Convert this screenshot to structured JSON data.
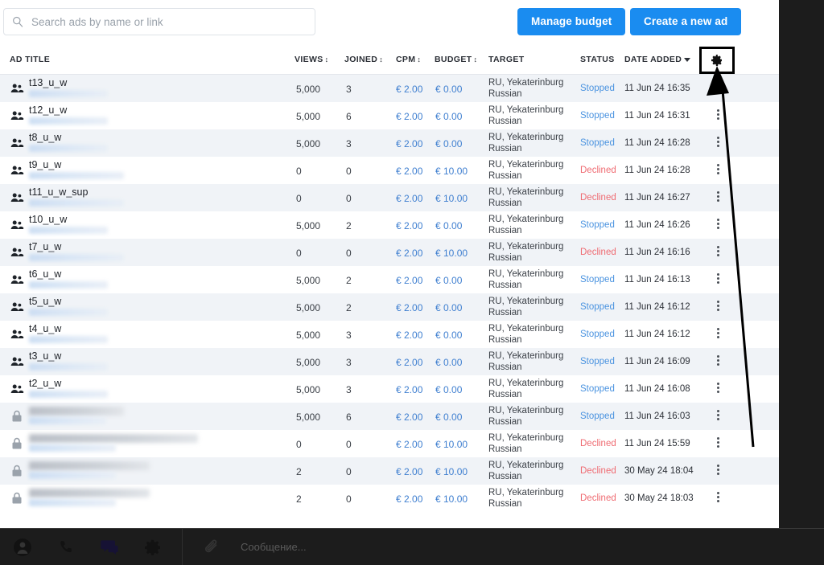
{
  "search": {
    "placeholder": "Search ads by name or link",
    "value": "",
    "icon": "search-icon"
  },
  "toolbar": {
    "manage_budget_label": "Manage budget",
    "create_ad_label": "Create a new ad",
    "accent_color": "#1a8cf0"
  },
  "table": {
    "columns": {
      "ad_title": "AD TITLE",
      "views": "VIEWS",
      "joined": "JOINED",
      "cpm": "CPM",
      "budget": "BUDGET",
      "target": "TARGET",
      "status": "STATUS",
      "date_added": "DATE ADDED"
    },
    "settings_icon": "gear-icon",
    "sort_glyph": "↕",
    "rows": [
      {
        "icon": "group-icon",
        "title": "t13_u_w",
        "redacted": false,
        "views": "5,000",
        "joined": "3",
        "cpm": "€ 2.00",
        "budget": "€ 0.00",
        "target_line1": "RU, Yekaterinburg",
        "target_line2": "Russian",
        "status": "Stopped",
        "status_type": "stopped",
        "date": "11 Jun 24 16:35"
      },
      {
        "icon": "group-icon",
        "title": "t12_u_w",
        "redacted": false,
        "views": "5,000",
        "joined": "6",
        "cpm": "€ 2.00",
        "budget": "€ 0.00",
        "target_line1": "RU, Yekaterinburg",
        "target_line2": "Russian",
        "status": "Stopped",
        "status_type": "stopped",
        "date": "11 Jun 24 16:31"
      },
      {
        "icon": "group-icon",
        "title": "t8_u_w",
        "redacted": false,
        "views": "5,000",
        "joined": "3",
        "cpm": "€ 2.00",
        "budget": "€ 0.00",
        "target_line1": "RU, Yekaterinburg",
        "target_line2": "Russian",
        "status": "Stopped",
        "status_type": "stopped",
        "date": "11 Jun 24 16:28"
      },
      {
        "icon": "group-icon",
        "title": "t9_u_w",
        "redacted": false,
        "views": "0",
        "joined": "0",
        "cpm": "€ 2.00",
        "budget": "€ 10.00",
        "target_line1": "RU, Yekaterinburg",
        "target_line2": "Russian",
        "status": "Declined",
        "status_type": "declined",
        "date": "11 Jun 24 16:28"
      },
      {
        "icon": "group-icon",
        "title": "t11_u_w_sup",
        "redacted": false,
        "views": "0",
        "joined": "0",
        "cpm": "€ 2.00",
        "budget": "€ 10.00",
        "target_line1": "RU, Yekaterinburg",
        "target_line2": "Russian",
        "status": "Declined",
        "status_type": "declined",
        "date": "11 Jun 24 16:27"
      },
      {
        "icon": "group-icon",
        "title": "t10_u_w",
        "redacted": false,
        "views": "5,000",
        "joined": "2",
        "cpm": "€ 2.00",
        "budget": "€ 0.00",
        "target_line1": "RU, Yekaterinburg",
        "target_line2": "Russian",
        "status": "Stopped",
        "status_type": "stopped",
        "date": "11 Jun 24 16:26"
      },
      {
        "icon": "group-icon",
        "title": "t7_u_w",
        "redacted": false,
        "views": "0",
        "joined": "0",
        "cpm": "€ 2.00",
        "budget": "€ 10.00",
        "target_line1": "RU, Yekaterinburg",
        "target_line2": "Russian",
        "status": "Declined",
        "status_type": "declined",
        "date": "11 Jun 24 16:16"
      },
      {
        "icon": "group-icon",
        "title": "t6_u_w",
        "redacted": false,
        "views": "5,000",
        "joined": "2",
        "cpm": "€ 2.00",
        "budget": "€ 0.00",
        "target_line1": "RU, Yekaterinburg",
        "target_line2": "Russian",
        "status": "Stopped",
        "status_type": "stopped",
        "date": "11 Jun 24 16:13"
      },
      {
        "icon": "group-icon",
        "title": "t5_u_w",
        "redacted": false,
        "views": "5,000",
        "joined": "2",
        "cpm": "€ 2.00",
        "budget": "€ 0.00",
        "target_line1": "RU, Yekaterinburg",
        "target_line2": "Russian",
        "status": "Stopped",
        "status_type": "stopped",
        "date": "11 Jun 24 16:12"
      },
      {
        "icon": "group-icon",
        "title": "t4_u_w",
        "redacted": false,
        "views": "5,000",
        "joined": "3",
        "cpm": "€ 2.00",
        "budget": "€ 0.00",
        "target_line1": "RU, Yekaterinburg",
        "target_line2": "Russian",
        "status": "Stopped",
        "status_type": "stopped",
        "date": "11 Jun 24 16:12"
      },
      {
        "icon": "group-icon",
        "title": "t3_u_w",
        "redacted": false,
        "views": "5,000",
        "joined": "3",
        "cpm": "€ 2.00",
        "budget": "€ 0.00",
        "target_line1": "RU, Yekaterinburg",
        "target_line2": "Russian",
        "status": "Stopped",
        "status_type": "stopped",
        "date": "11 Jun 24 16:09"
      },
      {
        "icon": "group-icon",
        "title": "t2_u_w",
        "redacted": false,
        "views": "5,000",
        "joined": "3",
        "cpm": "€ 2.00",
        "budget": "€ 0.00",
        "target_line1": "RU, Yekaterinburg",
        "target_line2": "Russian",
        "status": "Stopped",
        "status_type": "stopped",
        "date": "11 Jun 24 16:08"
      },
      {
        "icon": "lock-icon",
        "title": "",
        "redacted": true,
        "views": "5,000",
        "joined": "6",
        "cpm": "€ 2.00",
        "budget": "€ 0.00",
        "target_line1": "RU, Yekaterinburg",
        "target_line2": "Russian",
        "status": "Stopped",
        "status_type": "stopped",
        "date": "11 Jun 24 16:03"
      },
      {
        "icon": "lock-icon",
        "title": "",
        "redacted": true,
        "views": "0",
        "joined": "0",
        "cpm": "€ 2.00",
        "budget": "€ 10.00",
        "target_line1": "RU, Yekaterinburg",
        "target_line2": "Russian",
        "status": "Declined",
        "status_type": "declined",
        "date": "11 Jun 24 15:59"
      },
      {
        "icon": "lock-icon",
        "title": "",
        "redacted": true,
        "views": "2",
        "joined": "0",
        "cpm": "€ 2.00",
        "budget": "€ 10.00",
        "target_line1": "RU, Yekaterinburg",
        "target_line2": "Russian",
        "status": "Declined",
        "status_type": "declined",
        "date": "30 May 24 18:04"
      },
      {
        "icon": "lock-icon",
        "title": "",
        "redacted": true,
        "views": "2",
        "joined": "0",
        "cpm": "€ 2.00",
        "budget": "€ 10.00",
        "target_line1": "RU, Yekaterinburg",
        "target_line2": "Russian",
        "status": "Declined",
        "status_type": "declined",
        "date": "30 May 24 18:03"
      }
    ]
  },
  "annotation": {
    "type": "arrow-to-settings-gear",
    "color": "#000000"
  },
  "bottombar": {
    "icons": [
      "person-icon",
      "phone-icon",
      "chat-icon",
      "gear-icon",
      "paperclip-icon"
    ],
    "message_placeholder": "Сообщение..."
  }
}
